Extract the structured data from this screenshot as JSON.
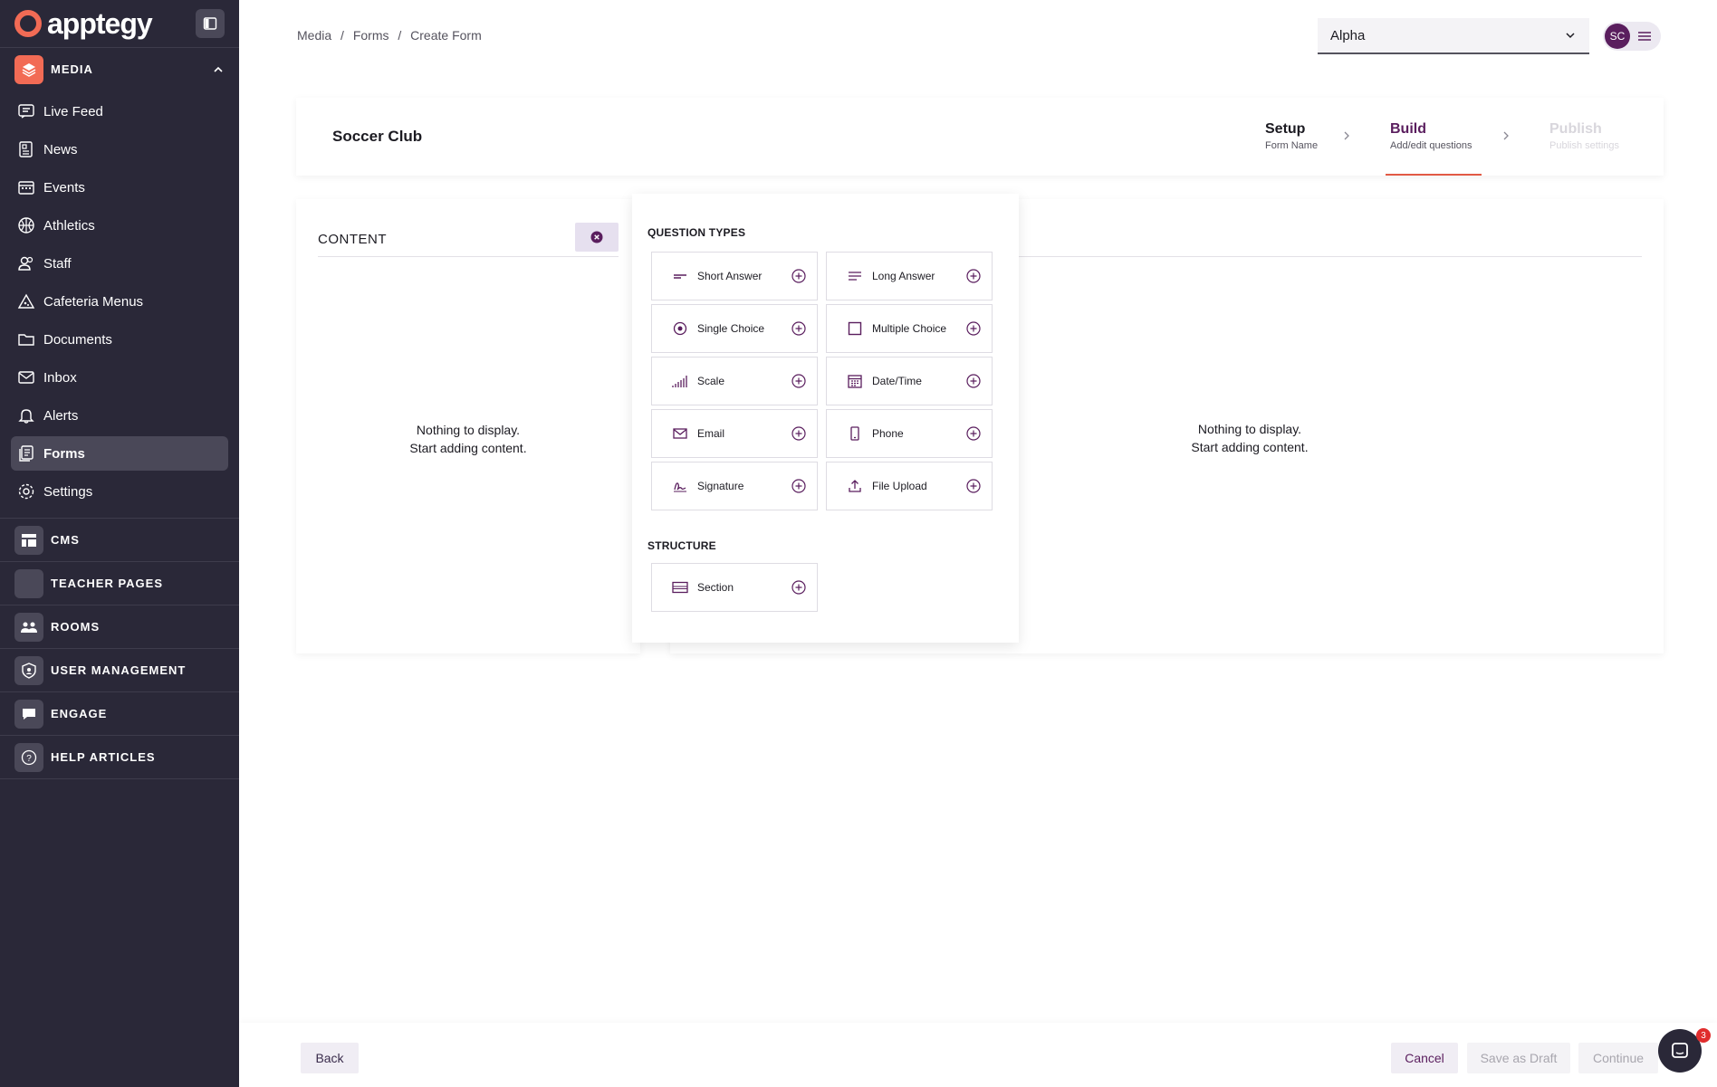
{
  "sidebar": {
    "logo_text": "apptegy",
    "media_label": "MEDIA",
    "items": [
      {
        "label": "Live Feed",
        "icon": "live-feed-icon"
      },
      {
        "label": "News",
        "icon": "news-icon"
      },
      {
        "label": "Events",
        "icon": "events-icon"
      },
      {
        "label": "Athletics",
        "icon": "athletics-icon"
      },
      {
        "label": "Staff",
        "icon": "staff-icon"
      },
      {
        "label": "Cafeteria Menus",
        "icon": "cafeteria-icon"
      },
      {
        "label": "Documents",
        "icon": "documents-icon"
      },
      {
        "label": "Inbox",
        "icon": "inbox-icon"
      },
      {
        "label": "Alerts",
        "icon": "alerts-icon"
      },
      {
        "label": "Forms",
        "icon": "forms-icon",
        "active": true
      },
      {
        "label": "Settings",
        "icon": "settings-icon"
      }
    ],
    "sections": [
      {
        "label": "CMS",
        "icon": "cms-icon"
      },
      {
        "label": "TEACHER PAGES",
        "icon": "teacher-pages-icon"
      },
      {
        "label": "ROOMS",
        "icon": "rooms-icon"
      },
      {
        "label": "USER MANAGEMENT",
        "icon": "user-management-icon"
      },
      {
        "label": "ENGAGE",
        "icon": "engage-icon"
      },
      {
        "label": "HELP ARTICLES",
        "icon": "help-articles-icon"
      }
    ]
  },
  "breadcrumb": [
    "Media",
    "/",
    "Forms",
    "/",
    "Create Form"
  ],
  "org_select": {
    "value": "Alpha"
  },
  "user": {
    "initials": "SC"
  },
  "form": {
    "title": "Soccer Club"
  },
  "steps": [
    {
      "title": "Setup",
      "sub": "Form Name"
    },
    {
      "title": "Build",
      "sub": "Add/edit questions"
    },
    {
      "title": "Publish",
      "sub": "Publish settings"
    }
  ],
  "content": {
    "label": "CONTENT",
    "empty_line1": "Nothing to display.",
    "empty_line2": "Start adding content."
  },
  "question_types": {
    "heading": "QUESTION TYPES",
    "items": [
      {
        "label": "Short Answer",
        "icon": "short-answer-icon"
      },
      {
        "label": "Long Answer",
        "icon": "long-answer-icon"
      },
      {
        "label": "Single Choice",
        "icon": "single-choice-icon"
      },
      {
        "label": "Multiple Choice",
        "icon": "multiple-choice-icon"
      },
      {
        "label": "Scale",
        "icon": "scale-icon"
      },
      {
        "label": "Date/Time",
        "icon": "date-time-icon"
      },
      {
        "label": "Email",
        "icon": "email-icon"
      },
      {
        "label": "Phone",
        "icon": "phone-icon"
      },
      {
        "label": "Signature",
        "icon": "signature-icon"
      },
      {
        "label": "File Upload",
        "icon": "file-upload-icon"
      }
    ]
  },
  "structure": {
    "heading": "STRUCTURE",
    "items": [
      {
        "label": "Section",
        "icon": "section-icon"
      }
    ]
  },
  "footer": {
    "back": "Back",
    "cancel": "Cancel",
    "save_draft": "Save as Draft",
    "continue": "Continue"
  },
  "chat": {
    "badge": "3"
  },
  "colors": {
    "sidebar_bg": "#2a2838",
    "brand_orange": "#f26b55",
    "accent_purple": "#5a1e5e",
    "step_underline": "#e25a45"
  }
}
